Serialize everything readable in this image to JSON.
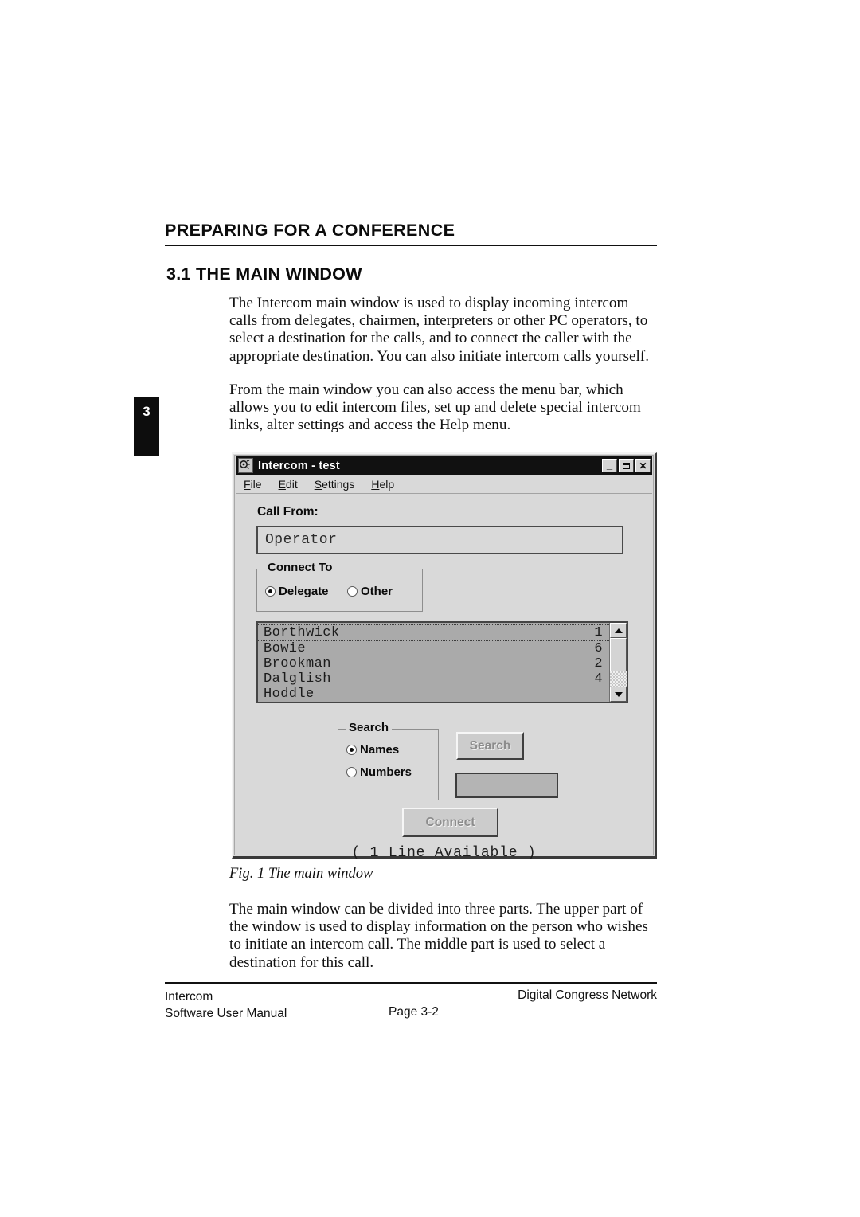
{
  "document": {
    "chapter_tab": "3",
    "heading_main": "PREPARING FOR A CONFERENCE",
    "heading_section": "3.1 THE MAIN WINDOW",
    "paragraph_1": "The Intercom main window is used to display incoming intercom calls from delegates, chairmen, interpreters or other PC operators, to select a destination for the calls, and to connect the caller with the appropriate destination. You can also initiate intercom calls yourself.",
    "paragraph_2": "From the main window you can also access the menu bar, which allows you to edit intercom files, set up and delete special intercom links, alter settings and access the Help menu.",
    "figure_caption": "Fig. 1 The main window",
    "paragraph_3": "The main window can be divided into three parts. The upper part of the window is used to display information on the person who wishes to initiate an intercom call. The middle part is used to select a destination for this call."
  },
  "footer": {
    "left_line1": "Intercom",
    "left_line2": "Software User Manual",
    "page": "Page 3-2",
    "right": "Digital Congress Network"
  },
  "dialog": {
    "title": "Intercom - test",
    "icon": "intercom-phone-icon",
    "window_buttons": {
      "minimize": "_",
      "maximize": "□",
      "close": "✕"
    },
    "menu": [
      {
        "accel": "F",
        "rest": "ile"
      },
      {
        "accel": "E",
        "rest": "dit"
      },
      {
        "accel": "S",
        "rest": "ettings"
      },
      {
        "accel": "H",
        "rest": "elp"
      }
    ],
    "call_from": {
      "label": "Call From:",
      "value": "Operator",
      "placeholder": ""
    },
    "connect_to": {
      "title": "Connect To",
      "options": [
        {
          "label": "Delegate",
          "selected": true
        },
        {
          "label": "Other",
          "selected": false
        }
      ]
    },
    "list": {
      "rows": [
        {
          "name": "Borthwick",
          "number": "1",
          "focused": true
        },
        {
          "name": "Bowie",
          "number": "6",
          "focused": false
        },
        {
          "name": "Brookman",
          "number": "2",
          "focused": false
        },
        {
          "name": "Dalglish",
          "number": "4",
          "focused": false
        },
        {
          "name": "Hoddle",
          "number": "",
          "focused": false
        }
      ]
    },
    "search": {
      "title": "Search",
      "options": [
        {
          "label": "Names",
          "selected": true
        },
        {
          "label": "Numbers",
          "selected": false
        }
      ],
      "button_label": "Search",
      "input_value": "",
      "input_placeholder": ""
    },
    "connect_button": "Connect",
    "status": "( 1 Line Available )",
    "colors": {
      "face": "#d9d9d9",
      "titlebar": "#111111",
      "list_bg": "#aaaaaa",
      "disabled_text": "#8c8c8c"
    }
  }
}
